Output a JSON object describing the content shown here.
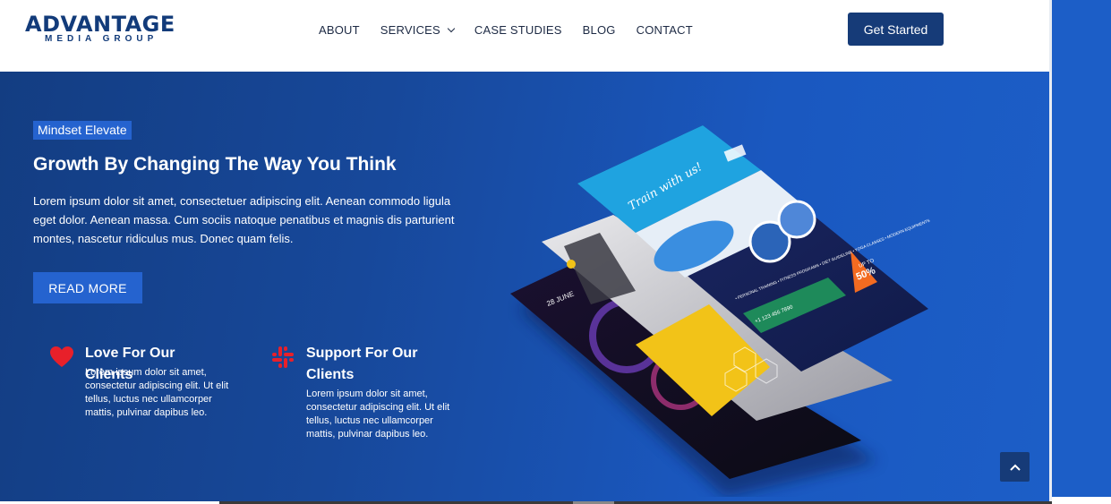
{
  "header": {
    "logo_main": "ADVANTAGE",
    "logo_sub": "MEDIA GROUP",
    "nav": [
      {
        "label": "ABOUT"
      },
      {
        "label": "SERVICES",
        "has_dropdown": true
      },
      {
        "label": "CASE STUDIES"
      },
      {
        "label": "BLOG"
      },
      {
        "label": "CONTACT"
      }
    ],
    "cta_label": "Get Started"
  },
  "hero": {
    "badge": "Mindset Elevate",
    "title": "Growth By Changing The Way You Think",
    "text": "Lorem ipsum dolor sit amet, consectetuer adipiscing elit. Aenean commodo ligula eget dolor. Aenean massa. Cum sociis natoque penatibus et magnis dis parturient montes, nascetur ridiculus mus. Donec quam felis.",
    "button_label": "READ MORE",
    "features": [
      {
        "icon": "heart-icon",
        "title": "Love For Our Clients",
        "text": "Lorem ipsum dolor sit amet, consectetur adipiscing elit. Ut elit tellus, luctus nec ullamcorper mattis, pulvinar dapibus leo."
      },
      {
        "icon": "slack-icon",
        "title": "Support For Our Clients",
        "text": "Lorem ipsum dolor sit amet, consectetur adipiscing elit. Ut elit tellus, luctus nec ullamcorper mattis, pulvinar dapibus leo."
      }
    ]
  },
  "mockup": {
    "flyer_heading": "Train with us!",
    "discount_label": "UP TO",
    "discount_value": "50%",
    "phone": "+1 123 456 7890",
    "date_label": "28 JUNE",
    "bullets": "• PERSONAL TRAINING • FITNESS PROGRAMS • DIET GUIDELINE • YOGA CLASSES • MODERN EQUIPMENTS"
  },
  "scroll_top_icon": "chevron-up-icon",
  "colors": {
    "brand_navy": "#163b78",
    "accent_blue": "#2563cf",
    "hero_start": "#133d82",
    "hero_end": "#1c5ec7",
    "heart_red": "#e8202a"
  }
}
